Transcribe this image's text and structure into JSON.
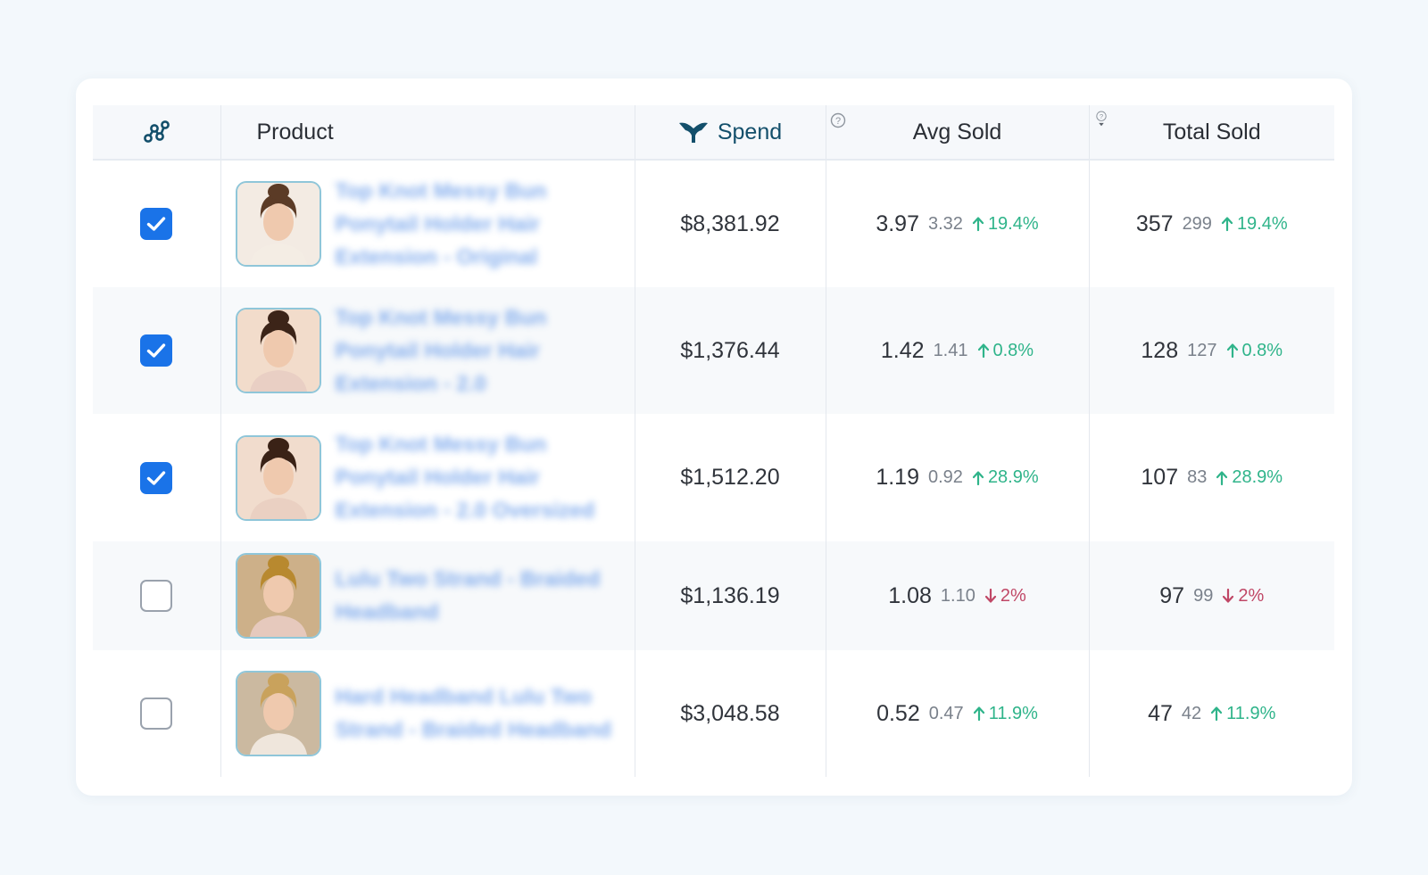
{
  "table": {
    "headers": {
      "product": "Product",
      "spend": "Spend",
      "avg_sold": "Avg Sold",
      "total_sold": "Total Sold"
    },
    "colors": {
      "accent": "#1a73e8",
      "up": "#2fb48a",
      "down": "#c04766",
      "link": "#5d94e8",
      "header_icon": "#134f6b"
    },
    "rows": [
      {
        "checked": true,
        "product": "Top Knot Messy Bun Ponytail Holder Hair Extension - Original",
        "spend": "$8,381.92",
        "avg": {
          "value": "3.97",
          "prev": "3.32",
          "direction": "up",
          "change": "19.4%"
        },
        "total": {
          "value": "357",
          "prev": "299",
          "direction": "up",
          "change": "19.4%"
        }
      },
      {
        "checked": true,
        "product": "Top Knot Messy Bun Ponytail Holder Hair Extension - 2.0",
        "spend": "$1,376.44",
        "avg": {
          "value": "1.42",
          "prev": "1.41",
          "direction": "up",
          "change": "0.8%"
        },
        "total": {
          "value": "128",
          "prev": "127",
          "direction": "up",
          "change": "0.8%"
        }
      },
      {
        "checked": true,
        "product": "Top Knot Messy Bun Ponytail Holder Hair Extension - 2.0 Oversized",
        "spend": "$1,512.20",
        "avg": {
          "value": "1.19",
          "prev": "0.92",
          "direction": "up",
          "change": "28.9%"
        },
        "total": {
          "value": "107",
          "prev": "83",
          "direction": "up",
          "change": "28.9%"
        }
      },
      {
        "checked": false,
        "product": "Lulu Two Strand - Braided Headband",
        "spend": "$1,136.19",
        "avg": {
          "value": "1.08",
          "prev": "1.10",
          "direction": "down",
          "change": "2%"
        },
        "total": {
          "value": "97",
          "prev": "99",
          "direction": "down",
          "change": "2%"
        }
      },
      {
        "checked": false,
        "product": "Hard Headband Lulu Two Strand - Braided Headband",
        "spend": "$3,048.58",
        "avg": {
          "value": "0.52",
          "prev": "0.47",
          "direction": "up",
          "change": "11.9%"
        },
        "total": {
          "value": "47",
          "prev": "42",
          "direction": "up",
          "change": "11.9%"
        }
      }
    ]
  }
}
